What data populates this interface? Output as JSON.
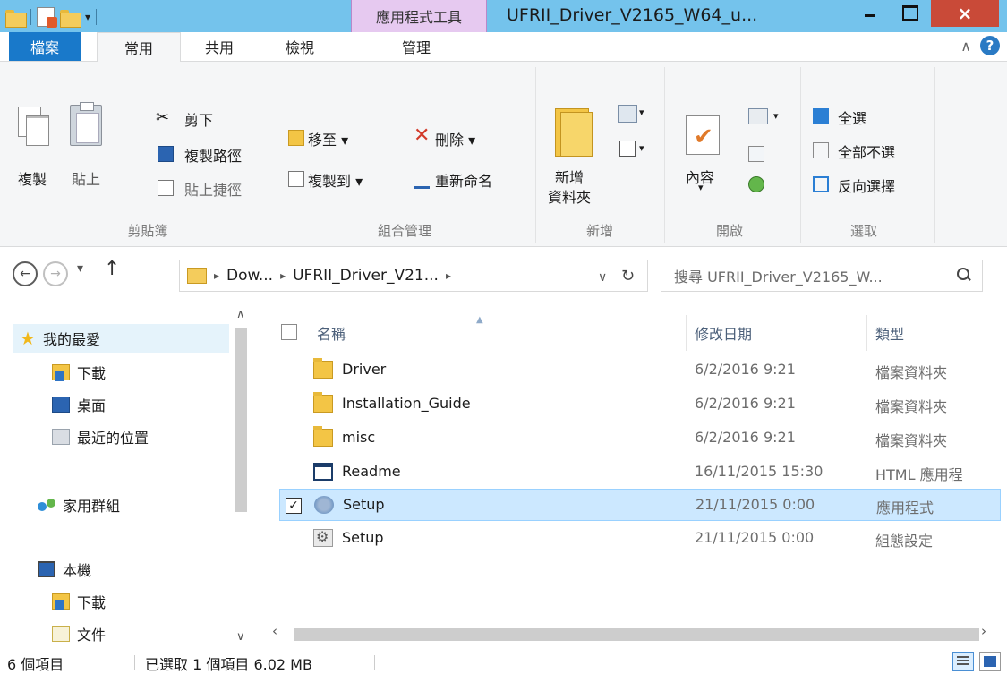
{
  "titlebar": {
    "context_tab": "應用程式工具",
    "title": "UFRII_Driver_V2165_W64_u...",
    "close_label": "×"
  },
  "ribbon_tabs": {
    "file": "檔案",
    "home": "常用",
    "share": "共用",
    "view": "檢視",
    "manage": "管理"
  },
  "ribbon": {
    "clipboard": {
      "copy": "複製",
      "paste": "貼上",
      "cut": "剪下",
      "copy_path": "複製路徑",
      "paste_shortcut": "貼上捷徑",
      "label": "剪貼簿"
    },
    "organize": {
      "move_to": "移至",
      "copy_to": "複製到",
      "delete": "刪除",
      "rename": "重新命名",
      "label": "組合管理"
    },
    "new": {
      "new_folder_line1": "新增",
      "new_folder_line2": "資料夾",
      "label": "新增"
    },
    "open": {
      "properties": "內容",
      "label": "開啟"
    },
    "select": {
      "select_all": "全選",
      "select_none": "全部不選",
      "invert": "反向選擇",
      "label": "選取"
    }
  },
  "address": {
    "crumbs": [
      "Dow...",
      "UFRII_Driver_V21..."
    ],
    "search_placeholder": "搜尋 UFRII_Driver_V2165_W..."
  },
  "navpane": {
    "favorites": "我的最愛",
    "downloads": "下載",
    "desktop": "桌面",
    "recent": "最近的位置",
    "homegroup": "家用群組",
    "this_pc": "本機",
    "pc_downloads": "下載",
    "documents": "文件"
  },
  "columns": {
    "name": "名稱",
    "modified": "修改日期",
    "type": "類型"
  },
  "files": [
    {
      "name": "Driver",
      "modified": "6/2/2016 9:21",
      "type": "檔案資料夾",
      "icon": "folder-icon"
    },
    {
      "name": "Installation_Guide",
      "modified": "6/2/2016 9:21",
      "type": "檔案資料夾",
      "icon": "folder-icon"
    },
    {
      "name": "misc",
      "modified": "6/2/2016 9:21",
      "type": "檔案資料夾",
      "icon": "folder-icon"
    },
    {
      "name": "Readme",
      "modified": "16/11/2015 15:30",
      "type": "HTML 應用程",
      "icon": "html-app-icon"
    },
    {
      "name": "Setup",
      "modified": "21/11/2015 0:00",
      "type": "應用程式",
      "icon": "setup-app-icon",
      "selected": true,
      "check": "✓"
    },
    {
      "name": "Setup",
      "modified": "21/11/2015 0:00",
      "type": "組態設定",
      "icon": "config-file-icon"
    }
  ],
  "status": {
    "count": "6 個項目",
    "selected": "已選取 1 個項目  6.02 MB"
  }
}
